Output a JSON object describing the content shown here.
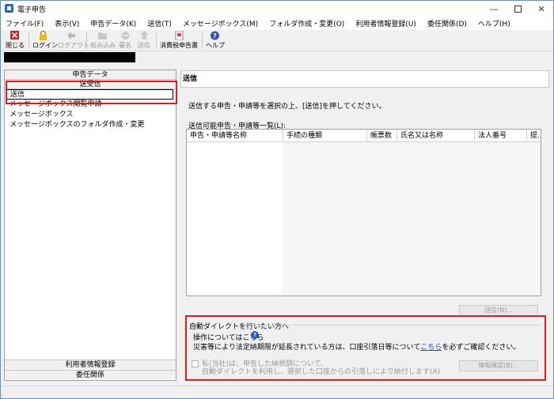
{
  "window": {
    "title": "電子申告"
  },
  "menu": [
    "ファイル(F)",
    "表示(V)",
    "申告データ(K)",
    "送信(T)",
    "メッセージボックス(M)",
    "フォルダ作成・変更(O)",
    "利用者情報登録(U)",
    "委任関係(D)",
    "ヘルプ(H)"
  ],
  "toolbar": {
    "close": "閉じる",
    "login": "ログイン",
    "logout": "ログアウト",
    "import": "組み込み",
    "sign": "署名",
    "send": "送信",
    "consumption_tax": "消費税申告書",
    "help": "ヘルプ"
  },
  "left_panel": {
    "header": "申告データ",
    "section": "送受信",
    "items": [
      "送信",
      "メッセージボックス閲覧申請",
      "メッセージボックス",
      "メッセージボックスのフォルダ作成・変更"
    ],
    "bottom_1": "利用者情報登録",
    "bottom_2": "委任関係"
  },
  "main": {
    "header": "送信",
    "instruction": "送信する申告・申請等を選択の上、[送信]を押してください。",
    "list_label": "送信可能申告・申請等一覧(L):",
    "columns": [
      "申告・申請等名称",
      "手続の種類",
      "帳票数",
      "氏名又は名称",
      "法人番号",
      "提..."
    ],
    "send_button": "送信(N)..."
  },
  "auto_debit": {
    "title": "自動ダイレクトを行いたい方へ",
    "operation": "操作についてはこちら",
    "disaster_before": "災害等により法定納期限が延長されている方は、口座引落日等について",
    "disaster_link": "こちら",
    "disaster_after": "を必ずご確認ください。",
    "agree_line1": "私(当社)は、申告した納税額について、",
    "agree_line2": "自動ダイレクトを利用し、選択した口座からの引落しにより納付します(A)",
    "info_button": "情報確認(B)..."
  },
  "colors": {
    "highlight": "#e01a22",
    "link": "#1a4cc8",
    "disabled": "#9a9a9a"
  }
}
